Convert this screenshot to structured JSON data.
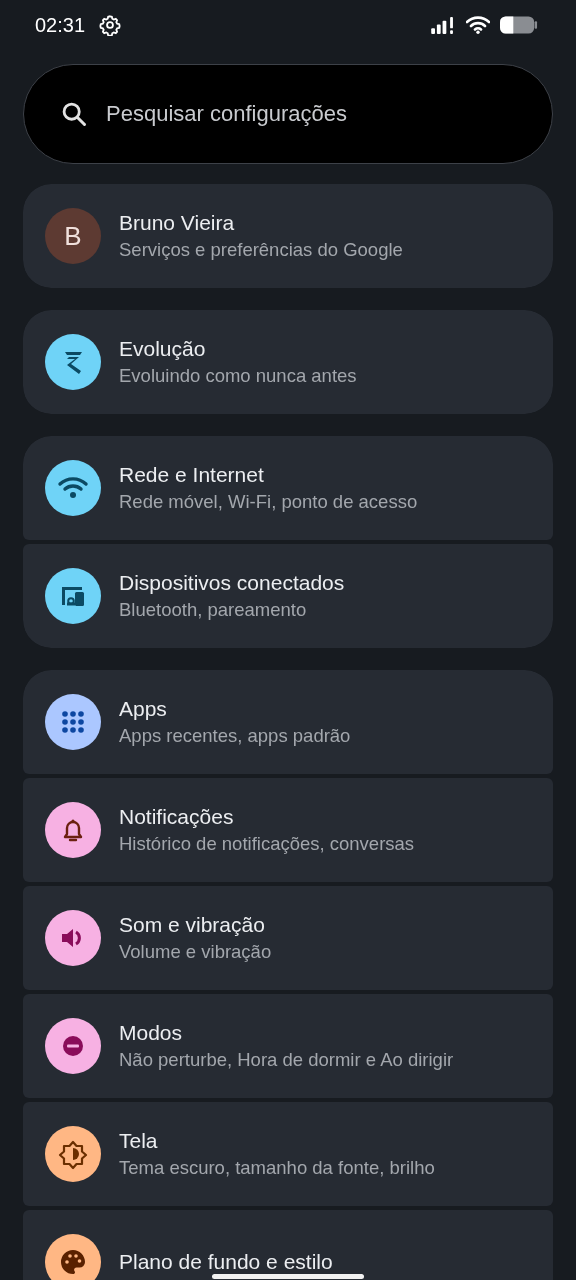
{
  "status_bar": {
    "time": "02:31"
  },
  "search": {
    "placeholder": "Pesquisar configurações"
  },
  "groups": [
    {
      "items": [
        {
          "kind": "account",
          "avatar_letter": "B",
          "title": "Bruno Vieira",
          "subtitle": "Serviços e preferências do Google",
          "color": "#5d3a32"
        }
      ]
    },
    {
      "items": [
        {
          "kind": "evolution",
          "title": "Evolução",
          "subtitle": "Evoluindo como nunca antes",
          "color": "#6fd3f7"
        }
      ]
    },
    {
      "items": [
        {
          "kind": "wifi",
          "title": "Rede e Internet",
          "subtitle": "Rede móvel, Wi-Fi, ponto de acesso",
          "color": "#6fd3f7"
        },
        {
          "kind": "devices",
          "title": "Dispositivos conectados",
          "subtitle": "Bluetooth, pareamento",
          "color": "#6fd3f7"
        }
      ]
    },
    {
      "items": [
        {
          "kind": "apps",
          "title": "Apps",
          "subtitle": "Apps recentes, apps padrão",
          "color": "#abc7ff"
        },
        {
          "kind": "bell",
          "title": "Notificações",
          "subtitle": "Histórico de notificações, conversas",
          "color": "#f7b1e3"
        },
        {
          "kind": "sound",
          "title": "Som e vibração",
          "subtitle": "Volume e vibração",
          "color": "#f7b1e3"
        },
        {
          "kind": "modes",
          "title": "Modos",
          "subtitle": "Não perturbe, Hora de dormir e Ao dirigir",
          "color": "#f7b1e3"
        },
        {
          "kind": "display",
          "title": "Tela",
          "subtitle": "Tema escuro, tamanho da fonte, brilho",
          "color": "#ffb784"
        },
        {
          "kind": "palette",
          "title": "Plano de fundo e estilo",
          "color": "#ffb784"
        }
      ]
    }
  ]
}
